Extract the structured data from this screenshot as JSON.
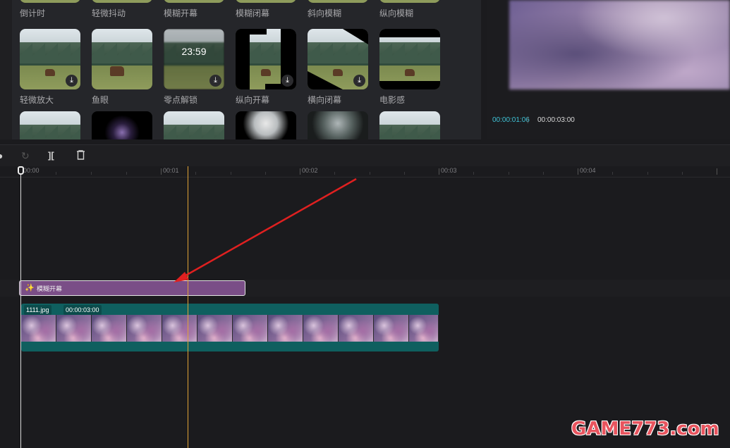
{
  "effects": {
    "top_row_labels": [
      "倒计时",
      "轻微抖动",
      "模糊开幕",
      "模糊闭幕",
      "斜向模糊",
      "纵向模糊"
    ],
    "middle_row": [
      {
        "label": "轻微放大",
        "download": true
      },
      {
        "label": "鱼眼",
        "download": false
      },
      {
        "label": "零点解锁",
        "download": true,
        "clock": "23:59"
      },
      {
        "label": "纵向开幕",
        "download": true
      },
      {
        "label": "横向闭幕",
        "download": true
      },
      {
        "label": "电影感",
        "download": false
      }
    ]
  },
  "preview": {
    "current_time": "00:00:01:06",
    "separator": "|",
    "total_time": "00:00:03:00"
  },
  "toolbar": {
    "redo_icon": "↻",
    "split_icon": "][",
    "delete_icon": "🗑"
  },
  "ruler": {
    "labels": [
      "00:00",
      "00:01",
      "00:02",
      "00:03",
      "00:04"
    ]
  },
  "tracks": {
    "effect_clip": {
      "icon": "✨",
      "label": "模糊开幕"
    },
    "video_clip": {
      "name": "1111.jpg",
      "duration": "00:00:03:00"
    }
  },
  "watermark": "GAME773.com",
  "colors": {
    "accent_time": "#3fc2d6",
    "effect_clip": "#7a4e87",
    "video_clip": "#0f5f5f",
    "playhead": "#e0a336",
    "arrow": "#e02020"
  }
}
